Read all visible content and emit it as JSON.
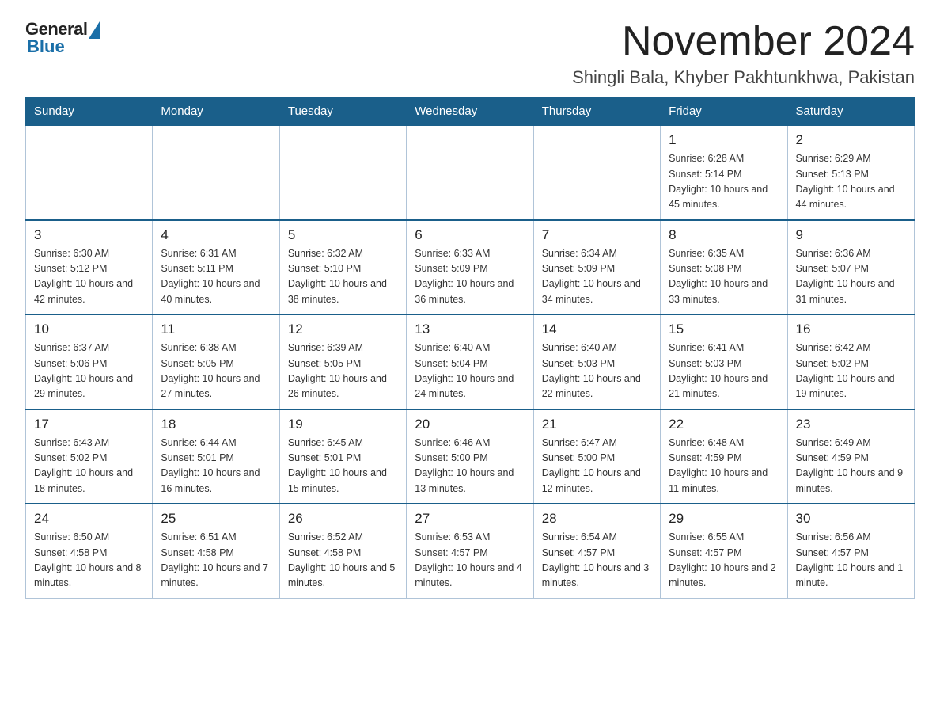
{
  "header": {
    "logo_general": "General",
    "logo_blue": "Blue",
    "month_title": "November 2024",
    "location": "Shingli Bala, Khyber Pakhtunkhwa, Pakistan"
  },
  "days_of_week": [
    "Sunday",
    "Monday",
    "Tuesday",
    "Wednesday",
    "Thursday",
    "Friday",
    "Saturday"
  ],
  "weeks": [
    [
      {
        "day": "",
        "info": ""
      },
      {
        "day": "",
        "info": ""
      },
      {
        "day": "",
        "info": ""
      },
      {
        "day": "",
        "info": ""
      },
      {
        "day": "",
        "info": ""
      },
      {
        "day": "1",
        "info": "Sunrise: 6:28 AM\nSunset: 5:14 PM\nDaylight: 10 hours and 45 minutes."
      },
      {
        "day": "2",
        "info": "Sunrise: 6:29 AM\nSunset: 5:13 PM\nDaylight: 10 hours and 44 minutes."
      }
    ],
    [
      {
        "day": "3",
        "info": "Sunrise: 6:30 AM\nSunset: 5:12 PM\nDaylight: 10 hours and 42 minutes."
      },
      {
        "day": "4",
        "info": "Sunrise: 6:31 AM\nSunset: 5:11 PM\nDaylight: 10 hours and 40 minutes."
      },
      {
        "day": "5",
        "info": "Sunrise: 6:32 AM\nSunset: 5:10 PM\nDaylight: 10 hours and 38 minutes."
      },
      {
        "day": "6",
        "info": "Sunrise: 6:33 AM\nSunset: 5:09 PM\nDaylight: 10 hours and 36 minutes."
      },
      {
        "day": "7",
        "info": "Sunrise: 6:34 AM\nSunset: 5:09 PM\nDaylight: 10 hours and 34 minutes."
      },
      {
        "day": "8",
        "info": "Sunrise: 6:35 AM\nSunset: 5:08 PM\nDaylight: 10 hours and 33 minutes."
      },
      {
        "day": "9",
        "info": "Sunrise: 6:36 AM\nSunset: 5:07 PM\nDaylight: 10 hours and 31 minutes."
      }
    ],
    [
      {
        "day": "10",
        "info": "Sunrise: 6:37 AM\nSunset: 5:06 PM\nDaylight: 10 hours and 29 minutes."
      },
      {
        "day": "11",
        "info": "Sunrise: 6:38 AM\nSunset: 5:05 PM\nDaylight: 10 hours and 27 minutes."
      },
      {
        "day": "12",
        "info": "Sunrise: 6:39 AM\nSunset: 5:05 PM\nDaylight: 10 hours and 26 minutes."
      },
      {
        "day": "13",
        "info": "Sunrise: 6:40 AM\nSunset: 5:04 PM\nDaylight: 10 hours and 24 minutes."
      },
      {
        "day": "14",
        "info": "Sunrise: 6:40 AM\nSunset: 5:03 PM\nDaylight: 10 hours and 22 minutes."
      },
      {
        "day": "15",
        "info": "Sunrise: 6:41 AM\nSunset: 5:03 PM\nDaylight: 10 hours and 21 minutes."
      },
      {
        "day": "16",
        "info": "Sunrise: 6:42 AM\nSunset: 5:02 PM\nDaylight: 10 hours and 19 minutes."
      }
    ],
    [
      {
        "day": "17",
        "info": "Sunrise: 6:43 AM\nSunset: 5:02 PM\nDaylight: 10 hours and 18 minutes."
      },
      {
        "day": "18",
        "info": "Sunrise: 6:44 AM\nSunset: 5:01 PM\nDaylight: 10 hours and 16 minutes."
      },
      {
        "day": "19",
        "info": "Sunrise: 6:45 AM\nSunset: 5:01 PM\nDaylight: 10 hours and 15 minutes."
      },
      {
        "day": "20",
        "info": "Sunrise: 6:46 AM\nSunset: 5:00 PM\nDaylight: 10 hours and 13 minutes."
      },
      {
        "day": "21",
        "info": "Sunrise: 6:47 AM\nSunset: 5:00 PM\nDaylight: 10 hours and 12 minutes."
      },
      {
        "day": "22",
        "info": "Sunrise: 6:48 AM\nSunset: 4:59 PM\nDaylight: 10 hours and 11 minutes."
      },
      {
        "day": "23",
        "info": "Sunrise: 6:49 AM\nSunset: 4:59 PM\nDaylight: 10 hours and 9 minutes."
      }
    ],
    [
      {
        "day": "24",
        "info": "Sunrise: 6:50 AM\nSunset: 4:58 PM\nDaylight: 10 hours and 8 minutes."
      },
      {
        "day": "25",
        "info": "Sunrise: 6:51 AM\nSunset: 4:58 PM\nDaylight: 10 hours and 7 minutes."
      },
      {
        "day": "26",
        "info": "Sunrise: 6:52 AM\nSunset: 4:58 PM\nDaylight: 10 hours and 5 minutes."
      },
      {
        "day": "27",
        "info": "Sunrise: 6:53 AM\nSunset: 4:57 PM\nDaylight: 10 hours and 4 minutes."
      },
      {
        "day": "28",
        "info": "Sunrise: 6:54 AM\nSunset: 4:57 PM\nDaylight: 10 hours and 3 minutes."
      },
      {
        "day": "29",
        "info": "Sunrise: 6:55 AM\nSunset: 4:57 PM\nDaylight: 10 hours and 2 minutes."
      },
      {
        "day": "30",
        "info": "Sunrise: 6:56 AM\nSunset: 4:57 PM\nDaylight: 10 hours and 1 minute."
      }
    ]
  ]
}
